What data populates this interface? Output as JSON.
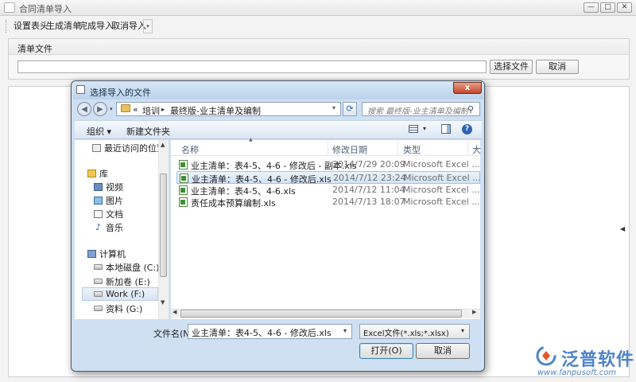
{
  "window": {
    "title": "合同清单导入",
    "min_label": "—",
    "max_label": "□",
    "close_label": "✕"
  },
  "toolbar": {
    "items": [
      "设置表头",
      "生成清单",
      "完成导入",
      "取消导入"
    ],
    "more_label": "▾"
  },
  "file_panel": {
    "title": "清单文件",
    "path_value": "",
    "choose_button": "选择文件",
    "cancel_button": "取消"
  },
  "dialog": {
    "title": "选择导入的文件",
    "close_label": "x",
    "breadcrumb": {
      "prefix": "«",
      "items": [
        "培训",
        "最终版-业主清单及编制"
      ],
      "separator": "▸"
    },
    "search_placeholder": "搜索 最终版-业主清单及编制",
    "commands": {
      "organize": "组织 ▾",
      "new_folder": "新建文件夹"
    },
    "nav_items": [
      {
        "label": "最近访问的位置",
        "icon": "recent-places-icon"
      },
      {
        "label": "库",
        "icon": "libraries-icon"
      },
      {
        "label": "视频",
        "icon": "videos-icon"
      },
      {
        "label": "图片",
        "icon": "pictures-icon"
      },
      {
        "label": "文档",
        "icon": "documents-icon"
      },
      {
        "label": "音乐",
        "icon": "music-icon"
      },
      {
        "label": "计算机",
        "icon": "computer-icon"
      },
      {
        "label": "本地磁盘 (C:)",
        "icon": "drive-icon"
      },
      {
        "label": "新加卷 (E:)",
        "icon": "drive-icon"
      },
      {
        "label": "Work (F:)",
        "icon": "drive-icon",
        "selected": true
      },
      {
        "label": "资料 (G:)",
        "icon": "drive-icon"
      }
    ],
    "columns": {
      "name": "名称",
      "date": "修改日期",
      "type": "类型",
      "size": "大"
    },
    "files": [
      {
        "name": "业主清单：表4-5、4-6 - 修改后 - 副本.xls",
        "date": "2014/7/29 20:09",
        "type": "Microsoft Excel ..."
      },
      {
        "name": "业主清单：表4-5、4-6 - 修改后.xls",
        "date": "2014/7/12 23:24",
        "type": "Microsoft Excel ...",
        "selected": true
      },
      {
        "name": "业主清单：表4-5、4-6.xls",
        "date": "2014/7/12 11:04",
        "type": "Microsoft Excel ..."
      },
      {
        "name": "责任成本预算编制.xls",
        "date": "2014/7/13 18:07",
        "type": "Microsoft Excel ..."
      }
    ],
    "filename_label": "文件名(N):",
    "filename_value": "业主清单：表4-5、4-6 - 修改后.xls",
    "filter_value": "Excel文件(*.xls;*.xlsx)",
    "open_button": "打开(O)",
    "cancel_button": "取消"
  },
  "watermark": {
    "brand": "泛普软件",
    "url": "www.fanpusoft.com"
  },
  "colors": {
    "dialog_frame": "#cfe0f2",
    "selection": "#d3e3f7",
    "brand_blue": "#4f84c6",
    "close_red": "#c2462b"
  }
}
